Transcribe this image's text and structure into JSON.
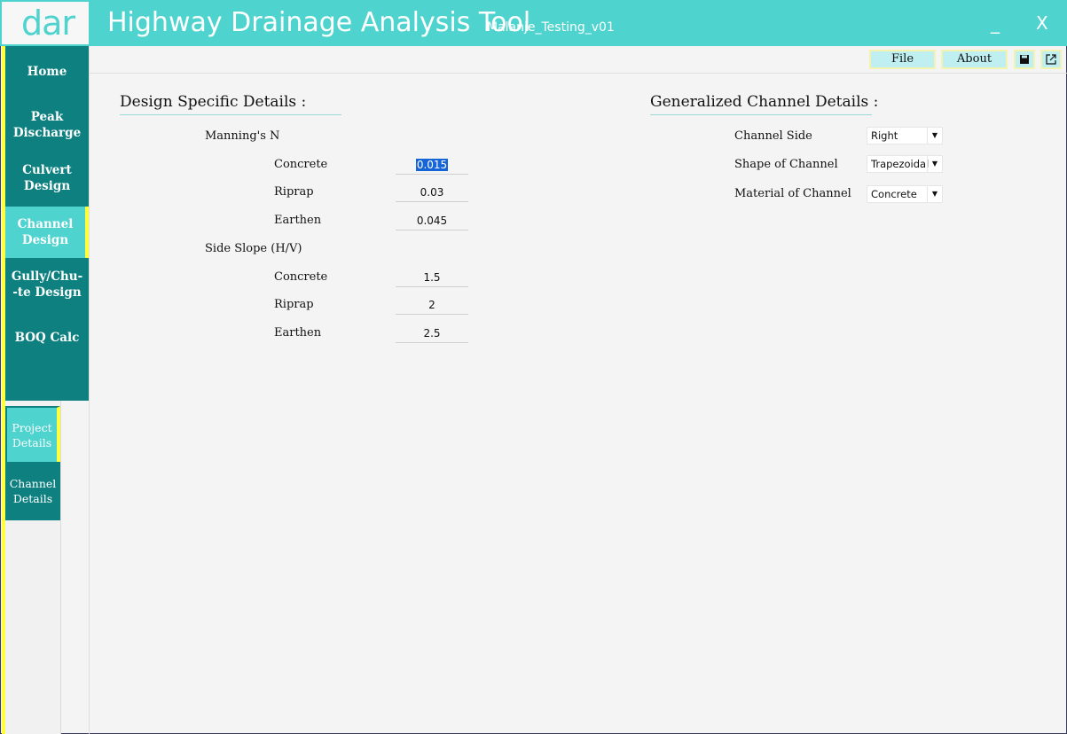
{
  "header": {
    "logo": "dar",
    "title": "Highway Drainage Analysis Tool",
    "project": "Malanje_Testing_v01",
    "minimize": "_",
    "close": "X"
  },
  "nav": {
    "items": [
      {
        "label": "Home"
      },
      {
        "label": "Peak\nDischarge"
      },
      {
        "label": "Culvert\nDesign"
      },
      {
        "label": "Channel\nDesign"
      },
      {
        "label": "Gully/Chu-\n-te Design"
      },
      {
        "label": "BOQ Calc"
      }
    ],
    "active": "Channel Design"
  },
  "subnav": {
    "items": [
      {
        "label": "Project\nDetails"
      },
      {
        "label": "Channel\nDetails"
      }
    ]
  },
  "toolbar": {
    "file": "File",
    "about": "About",
    "icons": [
      "save-icon",
      "export-icon"
    ]
  },
  "design": {
    "title": "Design Specific Details :",
    "mannings_label": "Manning's N",
    "side_slope_label": "Side Slope (H/V)",
    "mannings": [
      {
        "label": "Concrete",
        "value": "0.015"
      },
      {
        "label": "Riprap",
        "value": "0.03"
      },
      {
        "label": "Earthen",
        "value": "0.045"
      }
    ],
    "slopes": [
      {
        "label": "Concrete",
        "value": "1.5"
      },
      {
        "label": "Riprap",
        "value": "2"
      },
      {
        "label": "Earthen",
        "value": "2.5"
      }
    ]
  },
  "channel": {
    "title": "Generalized Channel Details :",
    "fields": [
      {
        "label": "Channel Side",
        "value": "Right"
      },
      {
        "label": "Shape of Channel",
        "value": "Trapezoidal"
      },
      {
        "label": "Material of Channel",
        "value": "Concrete"
      }
    ]
  },
  "colors": {
    "accent": "#4ed3cf",
    "nav_bg": "#0f8080",
    "highlight": "#ffff3a"
  }
}
